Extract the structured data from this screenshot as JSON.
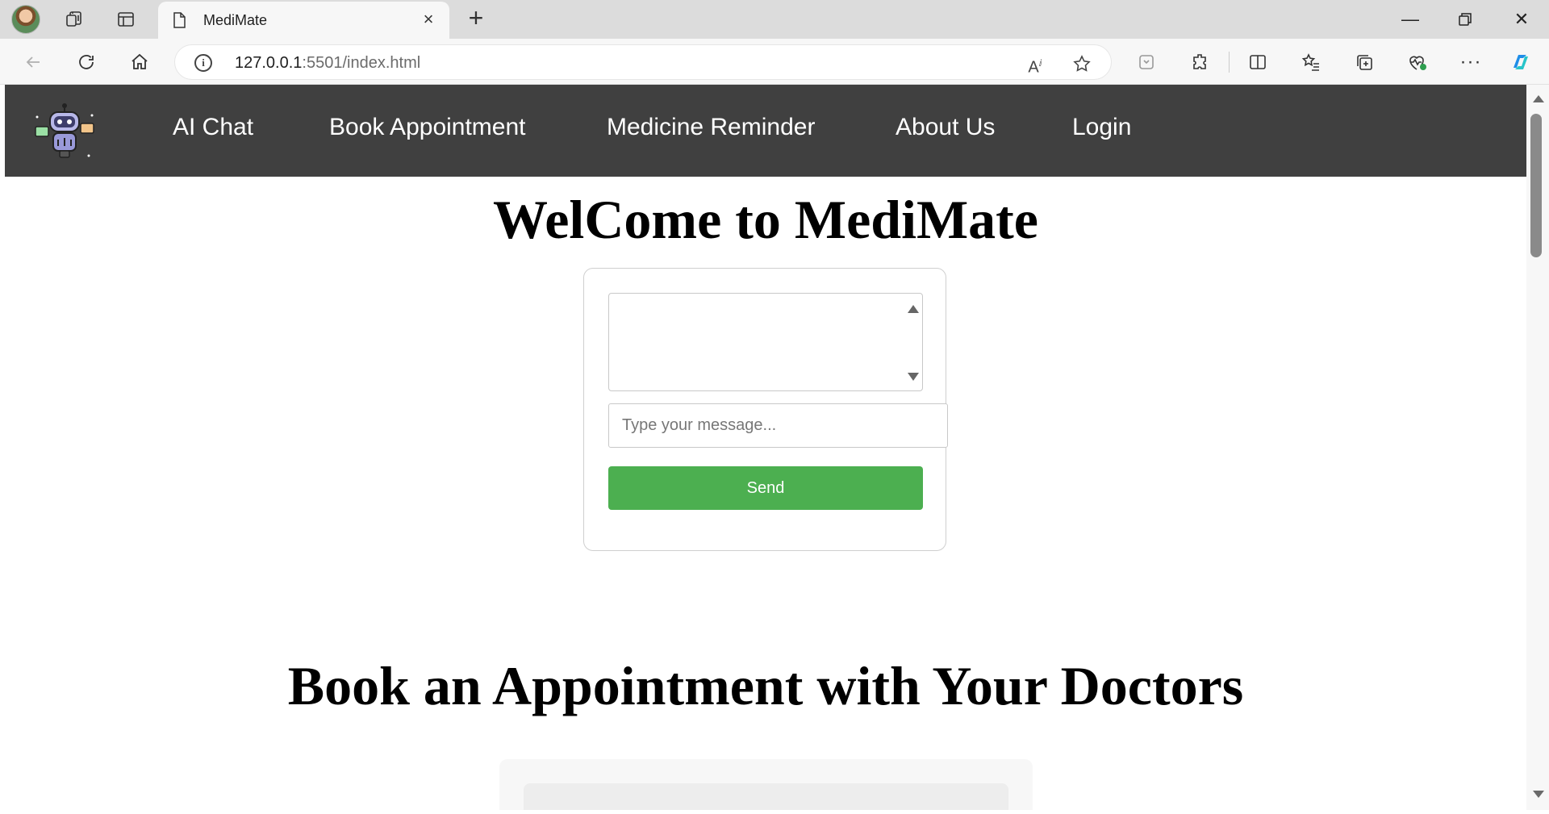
{
  "browser": {
    "tab_title": "MediMate",
    "address_host": "127.0.0.1",
    "address_rest": ":5501/index.html",
    "icons": {
      "profile": "avatar",
      "workspaces": "workspaces-icon",
      "tab_actions": "vertical-tabs-icon",
      "page": "page-icon",
      "close_tab": "close-icon",
      "new_tab": "plus-icon",
      "back": "back-arrow-icon",
      "refresh": "refresh-icon",
      "home": "home-icon",
      "site_info": "info-icon",
      "read_aloud": "read-aloud-icon",
      "favorite": "star-icon",
      "extensions": "puzzle-icon",
      "split": "split-screen-icon",
      "favorites": "favorites-icon",
      "collections": "collections-icon",
      "health": "heartbeat-icon",
      "more": "ellipsis-icon",
      "copilot": "copilot-icon"
    }
  },
  "site": {
    "nav": [
      "AI Chat",
      "Book Appointment",
      "Medicine Reminder",
      "About Us",
      "Login"
    ],
    "welcome_heading": "WelCome to MediMate",
    "chat": {
      "placeholder": "Type your message...",
      "send_label": "Send"
    },
    "book_heading": "Book an Appointment with Your Doctors"
  },
  "colors": {
    "navbar": "#404040",
    "send_button": "#4caf50"
  }
}
